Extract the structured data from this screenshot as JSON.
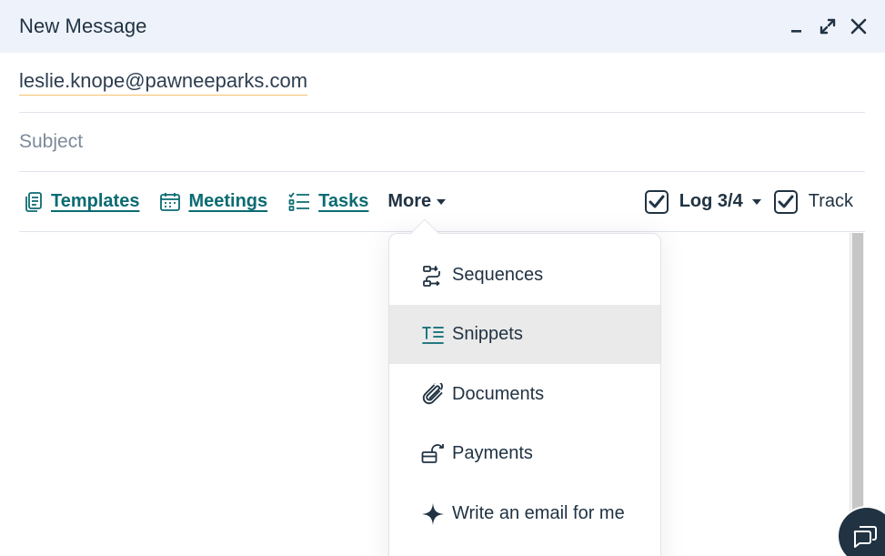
{
  "header": {
    "title": "New Message"
  },
  "compose": {
    "recipient": "leslie.knope@pawneeparks.com",
    "subject_placeholder": "Subject",
    "subject_value": ""
  },
  "toolbar": {
    "templates_label": "Templates",
    "meetings_label": "Meetings",
    "tasks_label": "Tasks",
    "more_label": "More",
    "log_label": "Log 3/4",
    "track_label": "Track",
    "log_checked": true,
    "track_checked": true
  },
  "more_menu": {
    "items": [
      {
        "label": "Sequences",
        "icon": "sequences-icon"
      },
      {
        "label": "Snippets",
        "icon": "snippets-icon"
      },
      {
        "label": "Documents",
        "icon": "paperclip-icon"
      },
      {
        "label": "Payments",
        "icon": "payments-icon"
      },
      {
        "label": "Write an email for me",
        "icon": "sparkle-icon"
      }
    ]
  },
  "colors": {
    "header_bg": "#eef3fb",
    "link_teal": "#0b6b72",
    "text_dark": "#213343",
    "menu_hover": "#eaeaea"
  }
}
